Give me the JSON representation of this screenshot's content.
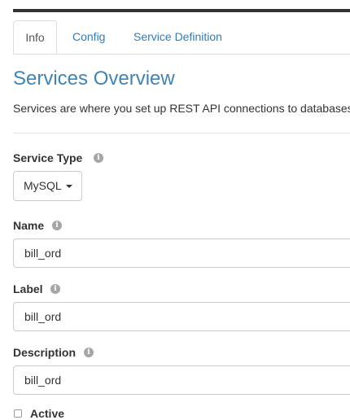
{
  "tabs": [
    {
      "label": "Info",
      "active": true
    },
    {
      "label": "Config",
      "active": false
    },
    {
      "label": "Service Definition",
      "active": false
    }
  ],
  "overview": {
    "title": "Services Overview",
    "description": "Services are where you set up REST API connections to databases"
  },
  "fields": {
    "service_type": {
      "label": "Service Type",
      "value": "MySQL",
      "icon": "info-circle-icon"
    },
    "name": {
      "label": "Name",
      "value": "bill_ord",
      "icon": "info-circle-icon"
    },
    "label": {
      "label": "Label",
      "value": "bill_ord",
      "icon": "info-circle-icon"
    },
    "description": {
      "label": "Description",
      "value": "bill_ord",
      "icon": "info-circle-icon"
    },
    "active": {
      "label": "Active"
    }
  },
  "colors": {
    "link": "#2f7dbd",
    "title": "#3f84b8",
    "text": "#333333",
    "border": "#cccccc"
  }
}
